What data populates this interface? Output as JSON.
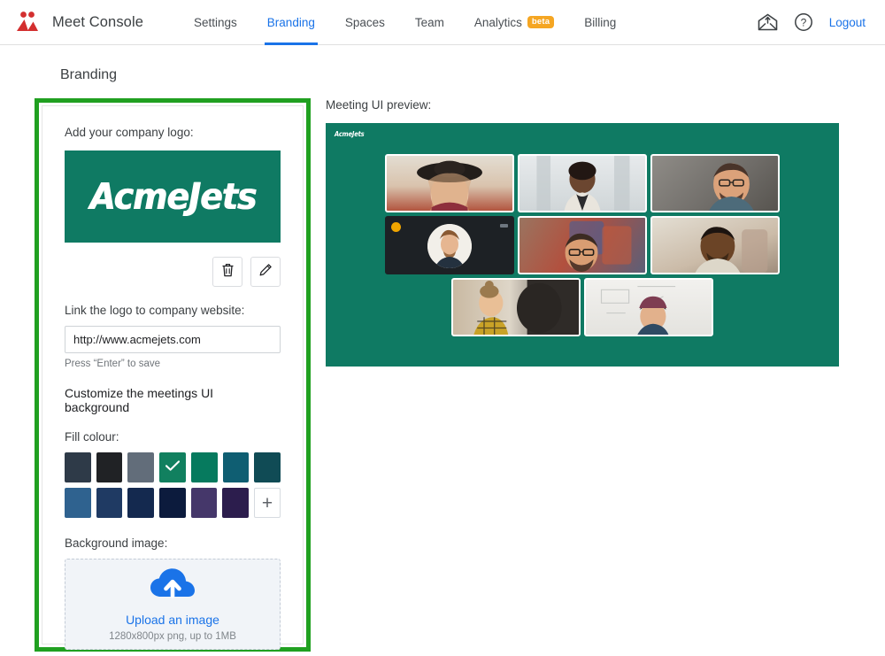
{
  "header": {
    "logo_icon": "meet-people-logo-icon",
    "logo_color": "#d32f2f",
    "title": "Meet Console",
    "nav": [
      {
        "label": "Settings",
        "active": false,
        "badge": null
      },
      {
        "label": "Branding",
        "active": true,
        "badge": null
      },
      {
        "label": "Spaces",
        "active": false,
        "badge": null
      },
      {
        "label": "Team",
        "active": false,
        "badge": null
      },
      {
        "label": "Analytics",
        "active": false,
        "badge": "beta"
      },
      {
        "label": "Billing",
        "active": false,
        "badge": null
      }
    ],
    "mail_icon": "envelope-icon",
    "help_icon": "help-circle-icon",
    "logout_label": "Logout",
    "accent_color": "#1a73e8",
    "badge_color": "#f5a623"
  },
  "page": {
    "title": "Branding",
    "highlight_color": "#20a020"
  },
  "branding": {
    "logo_label": "Add your company logo:",
    "company_logo_text": "AcmeJets",
    "logo_bg_color": "#0f7a63",
    "delete_icon": "trash-icon",
    "edit_icon": "pencil-icon",
    "link_label": "Link the logo to company website:",
    "website_url": "http://www.acmejets.com",
    "website_placeholder": "http://",
    "save_hint": "Press “Enter” to save",
    "customize_heading": "Customize the meetings UI background",
    "fill_label": "Fill colour:",
    "fill_colours": [
      {
        "hex": "#2e3a48",
        "selected": false
      },
      {
        "hex": "#202225",
        "selected": false
      },
      {
        "hex": "#626d7a",
        "selected": false
      },
      {
        "hex": "#11805f",
        "selected": true
      },
      {
        "hex": "#067a5e",
        "selected": false
      },
      {
        "hex": "#0f5e72",
        "selected": false
      },
      {
        "hex": "#104b55",
        "selected": false
      },
      {
        "hex": "#2f628f",
        "selected": false
      },
      {
        "hex": "#1f3a63",
        "selected": false
      },
      {
        "hex": "#14294f",
        "selected": false
      },
      {
        "hex": "#0c1b3d",
        "selected": false
      },
      {
        "hex": "#45376a",
        "selected": false
      },
      {
        "hex": "#2c1d4d",
        "selected": false
      }
    ],
    "add_colour_label": "+",
    "selected_check_icon": "check-icon",
    "background_label": "Background image:",
    "upload_icon": "cloud-upload-icon",
    "upload_link": "Upload an image",
    "upload_hint": "1280x800px png, up to 1MB",
    "upload_link_color": "#1a73e8"
  },
  "preview": {
    "label": "Meeting UI preview:",
    "background_color": "#0f7a63",
    "logo_text": "AcmeJets",
    "tiles": [
      [
        {
          "name": "participant-woman-hat",
          "type": "video",
          "bg": "#d9c3ad"
        },
        {
          "name": "participant-woman-blazer",
          "type": "video",
          "bg": "#d4d8da"
        },
        {
          "name": "participant-man-glasses-wall",
          "type": "video",
          "bg": "#8e8d8a"
        }
      ],
      [
        {
          "name": "participant-muted-avatar",
          "type": "avatar",
          "bg": "#1d2125",
          "badge": true,
          "pill": true
        },
        {
          "name": "participant-man-brick-wall",
          "type": "video",
          "bg": "#9a6b5a"
        },
        {
          "name": "participant-man-office",
          "type": "video",
          "bg": "#cbbba8"
        }
      ],
      [
        {
          "name": "participant-woman-plaid",
          "type": "video",
          "bg": "#b9a893"
        },
        {
          "name": "participant-person-beanie",
          "type": "video",
          "bg": "#e6e6e4"
        }
      ]
    ]
  }
}
